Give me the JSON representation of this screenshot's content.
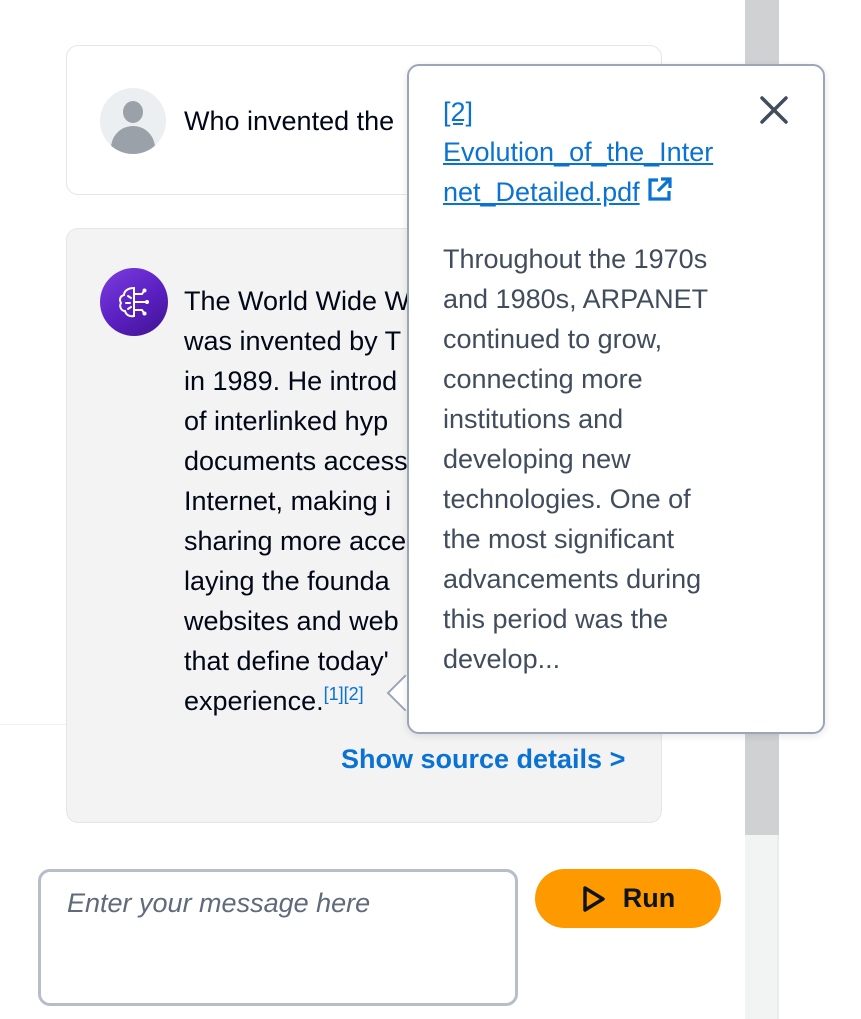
{
  "user_message": {
    "text": "Who invented the"
  },
  "ai_message": {
    "lines": [
      "The World Wide W",
      "was invented by T",
      "in 1989. He introd",
      "of interlinked hyp",
      "documents access",
      "Internet, making i",
      "sharing more acce",
      "laying the founda",
      "websites and web",
      "that define today'",
      "experience."
    ],
    "citations": [
      "[1]",
      "[2]"
    ],
    "show_source_label": "Show source details >"
  },
  "popover": {
    "link_text": "[2] Evolution_of_the_Internet_Detailed.pdf",
    "link_lines": [
      "[2]",
      "Evolution_of_the_Inter",
      "net_Detailed.pdf"
    ],
    "excerpt_lines": [
      "Throughout the 1970s",
      "and 1980s, ARPANET",
      "continued to grow,",
      "connecting more",
      "institutions and",
      "developing new",
      "technologies. One of",
      "the most significant",
      "advancements during",
      "this period was the",
      "develop..."
    ],
    "close_icon": "close-icon",
    "external_link_icon": "external-link-icon"
  },
  "composer": {
    "placeholder": "Enter your message here",
    "value": "",
    "run_label": "Run",
    "run_icon": "play-icon"
  },
  "colors": {
    "accent": "#0972d3",
    "run_button": "#ff9900",
    "ai_avatar": "#6a2bd6",
    "ai_card_bg": "#f3f3f3"
  }
}
